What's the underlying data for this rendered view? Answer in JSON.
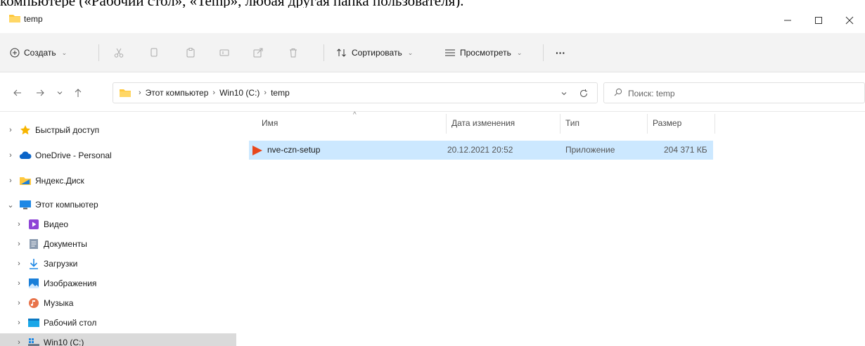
{
  "document_line": "компьютере («Рабочий стол», «Temp», любая другая папка пользователя).",
  "window": {
    "title": "temp",
    "minimize": "—",
    "maximize": "☐",
    "close": "✕"
  },
  "toolbar": {
    "create_label": "Создать",
    "sort_label": "Сортировать",
    "view_label": "Просмотреть",
    "more_label": "···"
  },
  "address": {
    "crumbs": [
      "Этот компьютер",
      "Win10 (C:)",
      "temp"
    ],
    "separator": "›"
  },
  "search": {
    "placeholder": "Поиск: temp"
  },
  "sidebar": {
    "items": [
      {
        "label": "Быстрый доступ",
        "icon": "star-icon",
        "expanded": false
      },
      {
        "label": "OneDrive - Personal",
        "icon": "cloud-icon",
        "expanded": false
      },
      {
        "label": "Яндекс.Диск",
        "icon": "yandex-disk-icon",
        "expanded": false
      },
      {
        "label": "Этот компьютер",
        "icon": "computer-icon",
        "expanded": true
      },
      {
        "label": "Видео",
        "icon": "video-icon",
        "expanded": false
      },
      {
        "label": "Документы",
        "icon": "documents-icon",
        "expanded": false
      },
      {
        "label": "Загрузки",
        "icon": "downloads-icon",
        "expanded": false
      },
      {
        "label": "Изображения",
        "icon": "pictures-icon",
        "expanded": false
      },
      {
        "label": "Музыка",
        "icon": "music-icon",
        "expanded": false
      },
      {
        "label": "Рабочий стол",
        "icon": "desktop-icon",
        "expanded": false
      },
      {
        "label": "Win10 (C:)",
        "icon": "drive-icon",
        "expanded": false,
        "selected": true
      }
    ]
  },
  "columns": {
    "name": "Имя",
    "modified": "Дата изменения",
    "type": "Тип",
    "size": "Размер"
  },
  "files": [
    {
      "name": "nve-czn-setup",
      "modified": "20.12.2021 20:52",
      "type": "Приложение",
      "size": "204 371 КБ",
      "icon": "app-play-icon",
      "selected": true
    }
  ],
  "colors": {
    "accent": "#0067c0",
    "selection": "#cce8ff",
    "toolbar_bg": "#f3f3f3",
    "folder": "#ffc83d"
  }
}
